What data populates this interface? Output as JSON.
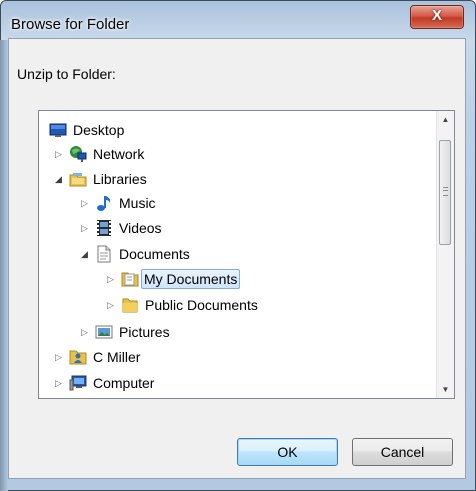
{
  "window": {
    "title": "Browse for Folder",
    "close_label": "X"
  },
  "prompt": "Unzip to Folder:",
  "tree": [
    {
      "label": "Desktop",
      "icon": "desktop-icon",
      "expander": "none"
    },
    {
      "label": "Network",
      "icon": "network-icon",
      "expander": "collapsed"
    },
    {
      "label": "Libraries",
      "icon": "libraries-icon",
      "expander": "expanded"
    },
    {
      "label": "Music",
      "icon": "music-icon",
      "expander": "collapsed"
    },
    {
      "label": "Videos",
      "icon": "videos-icon",
      "expander": "collapsed"
    },
    {
      "label": "Documents",
      "icon": "documents-icon",
      "expander": "expanded"
    },
    {
      "label": "My Documents",
      "icon": "folder-icon",
      "expander": "collapsed",
      "selected": true
    },
    {
      "label": "Public Documents",
      "icon": "folder-icon",
      "expander": "collapsed"
    },
    {
      "label": "Pictures",
      "icon": "pictures-icon",
      "expander": "collapsed"
    },
    {
      "label": "C Miller",
      "icon": "user-folder-icon",
      "expander": "collapsed"
    },
    {
      "label": "Computer",
      "icon": "computer-icon",
      "expander": "collapsed"
    }
  ],
  "buttons": {
    "ok": "OK",
    "cancel": "Cancel"
  },
  "colors": {
    "selection_border": "#84acdd",
    "selection_fill": "#cfe4fa",
    "close_red": "#c23a26",
    "folder_yellow": "#e8c04a"
  }
}
